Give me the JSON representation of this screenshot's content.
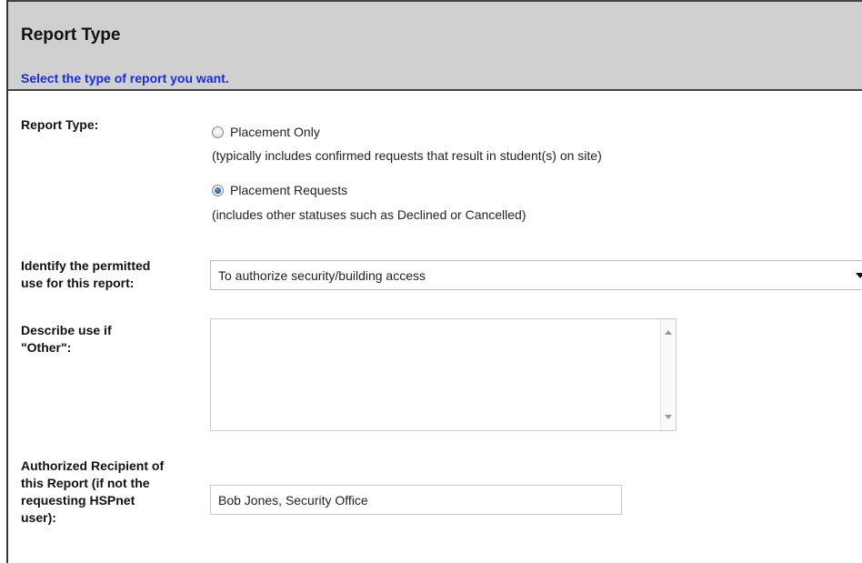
{
  "header": {
    "title": "Report Type",
    "subtitle": "Select the type of report you want."
  },
  "report_type": {
    "label": "Report Type:",
    "options": [
      {
        "label": "Placement Only",
        "description": "(typically includes confirmed requests that result in student(s) on site)",
        "selected": false
      },
      {
        "label": "Placement Requests",
        "description": "(includes other statuses such as Declined or Cancelled)",
        "selected": true
      }
    ]
  },
  "permitted_use": {
    "label_line1": "Identify the permitted",
    "label_line2": "use for this report:",
    "selected_value": "To authorize security/building access"
  },
  "describe_use": {
    "label_line1": "Describe use if",
    "label_line2": "\"Other\":",
    "value": ""
  },
  "recipient": {
    "label_line1": "Authorized Recipient of",
    "label_line2": "this Report (if not the",
    "label_line3": "requesting HSPnet",
    "label_line4": "user):",
    "value": "Bob Jones, Security Office"
  },
  "icons": {
    "select_arrow": "chevron-down-icon",
    "scroll_up": "arrow-up-icon",
    "scroll_down": "arrow-down-icon"
  },
  "colors": {
    "header_bg": "#d0d0d0",
    "subtitle_text": "#1a2bd8",
    "radio_selected": "#1f4f8f"
  }
}
